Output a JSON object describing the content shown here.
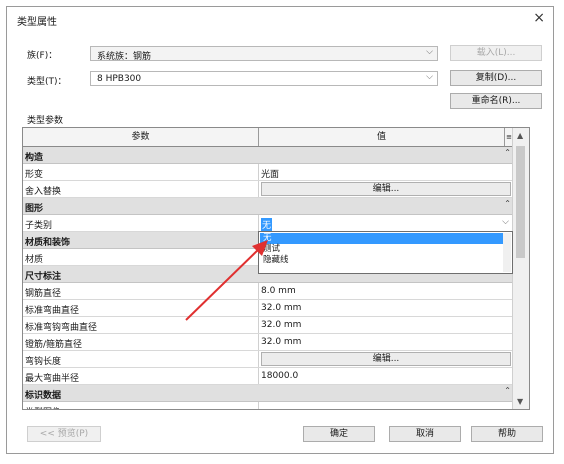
{
  "window": {
    "title": "类型属性",
    "close_glyph": "×"
  },
  "family": {
    "label": "族(F)：",
    "value": "系统族：钢筋"
  },
  "type": {
    "label": "类型(T)：",
    "value": "8 HPB300"
  },
  "buttons": {
    "load": "载入(L)...",
    "duplicate": "复制(D)...",
    "rename": "重命名(R)...",
    "preview": "<< 预览(P)",
    "ok": "确定",
    "cancel": "取消",
    "help": "帮助"
  },
  "section_label": "类型参数",
  "table": {
    "headers": [
      "参数",
      "值"
    ],
    "rows": [
      {
        "kind": "group",
        "label": "构造"
      },
      {
        "kind": "param",
        "label": "形变",
        "value": "光面"
      },
      {
        "kind": "button",
        "label": "舍入替换",
        "value": "编辑..."
      },
      {
        "kind": "group",
        "label": "图形"
      },
      {
        "kind": "combo",
        "label": "子类别",
        "value": "无"
      },
      {
        "kind": "group",
        "label": "材质和装饰"
      },
      {
        "kind": "param",
        "label": "材质",
        "value": ""
      },
      {
        "kind": "group",
        "label": "尺寸标注"
      },
      {
        "kind": "param",
        "label": "钢筋直径",
        "value": "8.0 mm"
      },
      {
        "kind": "param",
        "label": "标准弯曲直径",
        "value": "32.0 mm"
      },
      {
        "kind": "param",
        "label": "标准弯钩弯曲直径",
        "value": "32.0 mm"
      },
      {
        "kind": "param",
        "label": "镫筋/箍筋直径",
        "value": "32.0 mm"
      },
      {
        "kind": "button",
        "label": "弯钩长度",
        "value": "编辑..."
      },
      {
        "kind": "param",
        "label": "最大弯曲半径",
        "value": "18000.0"
      },
      {
        "kind": "group",
        "label": "标识数据"
      },
      {
        "kind": "param",
        "label": "类型图像",
        "value": ""
      }
    ]
  },
  "dropdown": {
    "options": [
      "无",
      "测试",
      "隐藏线"
    ],
    "selected_index": 0
  },
  "colors": {
    "selection": "#3399ff",
    "annotation_arrow": "#e03030"
  }
}
